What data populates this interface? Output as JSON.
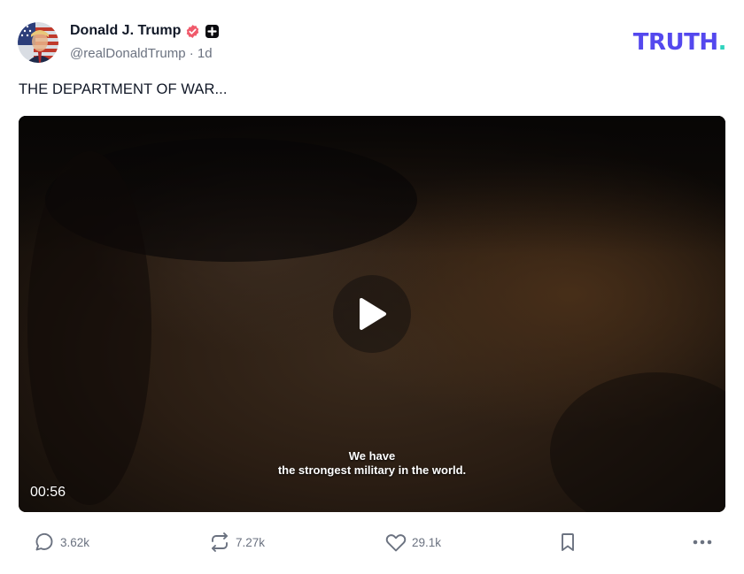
{
  "author": {
    "display_name": "Donald J. Trump",
    "handle": "@realDonaldTrump",
    "separator": "·",
    "time_ago": "1d",
    "verified_icon": "verified-badge-icon",
    "plus_icon": "plus-square-icon"
  },
  "brand": {
    "logo_text": "TRUTH",
    "logo_dot": ".",
    "color_primary": "#5448ee",
    "color_dot": "#2ed3bd"
  },
  "post": {
    "text": "THE DEPARTMENT OF WAR..."
  },
  "video": {
    "caption_line1": "We have",
    "caption_line2": "the strongest military in the world.",
    "duration": "00:56",
    "play_icon": "play-icon"
  },
  "actions": {
    "replies": "3.62k",
    "retruths": "7.27k",
    "likes": "29.1k",
    "bookmark_icon": "bookmark-icon",
    "more_icon": "more-horizontal-icon"
  }
}
